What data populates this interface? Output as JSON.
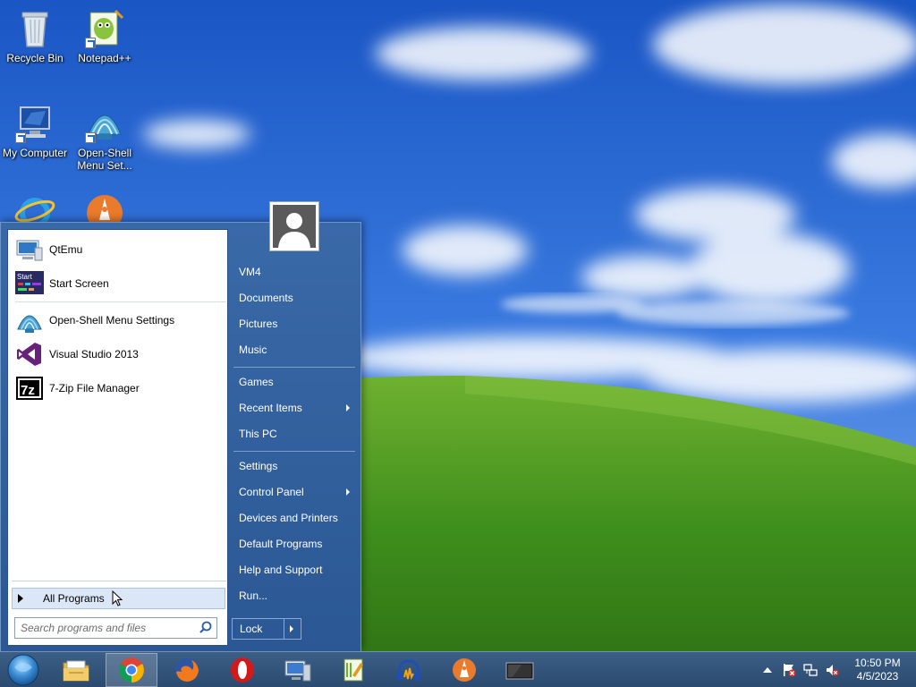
{
  "desktop": {
    "icons": [
      {
        "label": "Recycle Bin",
        "icon": "recycle-bin-icon"
      },
      {
        "label": "Notepad++",
        "icon": "notepadpp-icon"
      },
      {
        "label": "My Computer",
        "icon": "my-computer-icon"
      },
      {
        "label": "Open-Shell Menu Set...",
        "icon": "open-shell-icon"
      },
      {
        "label": "",
        "icon": "internet-explorer-icon"
      },
      {
        "label": "",
        "icon": "vlc-like-orange-icon"
      }
    ]
  },
  "start_menu": {
    "programs": [
      {
        "label": "QtEmu",
        "icon": "qtemu-icon"
      },
      {
        "label": "Start Screen",
        "icon": "start-screen-icon",
        "icon_text": "Start"
      },
      {
        "label": "Open-Shell Menu Settings",
        "icon": "open-shell-icon"
      },
      {
        "label": "Visual Studio 2013",
        "icon": "visual-studio-icon"
      },
      {
        "label": "7-Zip File Manager",
        "icon": "seven-zip-icon",
        "icon_text": "7z"
      }
    ],
    "all_programs_label": "All Programs",
    "search_placeholder": "Search programs and files",
    "right_items": [
      {
        "label": "VM4",
        "submenu": false
      },
      {
        "label": "Documents",
        "submenu": false
      },
      {
        "label": "Pictures",
        "submenu": false
      },
      {
        "label": "Music",
        "submenu": false
      },
      {
        "label": "Games",
        "submenu": false
      },
      {
        "label": "Recent Items",
        "submenu": true
      },
      {
        "label": "This PC",
        "submenu": false
      },
      {
        "label": "Settings",
        "submenu": false
      },
      {
        "label": "Control Panel",
        "submenu": true
      },
      {
        "label": "Devices and Printers",
        "submenu": false
      },
      {
        "label": "Default Programs",
        "submenu": false
      },
      {
        "label": "Help and Support",
        "submenu": false
      },
      {
        "label": "Run...",
        "submenu": false
      }
    ],
    "lock_label": "Lock"
  },
  "taskbar": {
    "pinned": [
      {
        "name": "file-explorer-icon"
      },
      {
        "name": "chrome-icon",
        "active": true
      },
      {
        "name": "firefox-icon"
      },
      {
        "name": "opera-icon"
      },
      {
        "name": "computer-monitor-icon"
      },
      {
        "name": "notepadpp-icon"
      },
      {
        "name": "headphones-audio-icon"
      },
      {
        "name": "orange-app-icon"
      },
      {
        "name": "screen-display-icon"
      }
    ],
    "tray": {
      "icons": [
        "show-hidden-icons-chevron",
        "action-center-flag-icon",
        "network-icon",
        "volume-muted-icon"
      ]
    },
    "clock": {
      "time": "10:50 PM",
      "date": "4/5/2023"
    }
  },
  "colors": {
    "sky": "#2a64c8",
    "grass": "#3f8a1d",
    "start_menu_bg": "#3a69a8",
    "taskbar_bg": "#34557b"
  }
}
